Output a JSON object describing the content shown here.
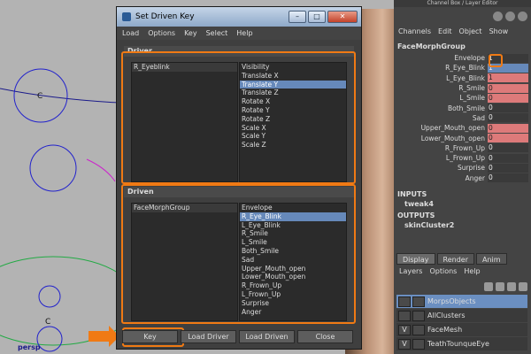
{
  "viewport": {
    "label": "persp",
    "locator_label_1": "C",
    "locator_label_2": "C"
  },
  "dialog": {
    "title": "Set Driven Key",
    "menus": [
      "Load",
      "Options",
      "Key",
      "Select",
      "Help"
    ],
    "driver": {
      "section_label": "Driver",
      "object": "R_Eyeblink",
      "attributes": [
        "Visibility",
        "Translate X",
        "Translate Y",
        "Translate Z",
        "Rotate X",
        "Rotate Y",
        "Rotate Z",
        "Scale X",
        "Scale Y",
        "Scale Z"
      ],
      "selected_attribute": "Translate Y"
    },
    "driven": {
      "section_label": "Driven",
      "object": "FaceMorphGroup",
      "attributes": [
        "Envelope",
        "R_Eye_Blink",
        "L_Eye_Blink",
        "R_Smile",
        "L_Smile",
        "Both_Smile",
        "Sad",
        "Upper_Mouth_open",
        "Lower_Mouth_open",
        "R_Frown_Up",
        "L_Frown_Up",
        "Surprise",
        "Anger"
      ],
      "selected_attribute": "R_Eye_Blink"
    },
    "buttons": {
      "key": "Key",
      "load_driver": "Load Driver",
      "load_driven": "Load Driven",
      "close": "Close"
    },
    "highlight_color": "#f07a14"
  },
  "channel_box": {
    "title": "Channel Box / Layer Editor",
    "menus": [
      "Channels",
      "Edit",
      "Object",
      "Show"
    ],
    "object": "FaceMorphGroup",
    "attributes": [
      {
        "name": "Envelope",
        "value": "1"
      },
      {
        "name": "R_Eye_Blink",
        "value": "1"
      },
      {
        "name": "L_Eye_Blink",
        "value": "1"
      },
      {
        "name": "R_Smile",
        "value": "0"
      },
      {
        "name": "L_Smile",
        "value": "0"
      },
      {
        "name": "Both_Smile",
        "value": "0"
      },
      {
        "name": "Sad",
        "value": "0"
      },
      {
        "name": "Upper_Mouth_open",
        "value": "0"
      },
      {
        "name": "Lower_Mouth_open",
        "value": "0"
      },
      {
        "name": "R_Frown_Up",
        "value": "0"
      },
      {
        "name": "L_Frown_Up",
        "value": "0"
      },
      {
        "name": "Surprise",
        "value": "0"
      },
      {
        "name": "Anger",
        "value": "0"
      }
    ],
    "inputs_label": "INPUTS",
    "inputs_node": "tweak4",
    "outputs_label": "OUTPUTS",
    "outputs_node": "skinCluster2",
    "tabs": [
      "Display",
      "Render",
      "Anim"
    ],
    "layer_menus": [
      "Layers",
      "Options",
      "Help"
    ],
    "layers": [
      {
        "name": "MorpsObjects",
        "v": "",
        "selected": true
      },
      {
        "name": "AllClusters",
        "v": ""
      },
      {
        "name": "FaceMesh",
        "v": "V"
      },
      {
        "name": "TeathTounqueEye",
        "v": "V"
      }
    ]
  }
}
